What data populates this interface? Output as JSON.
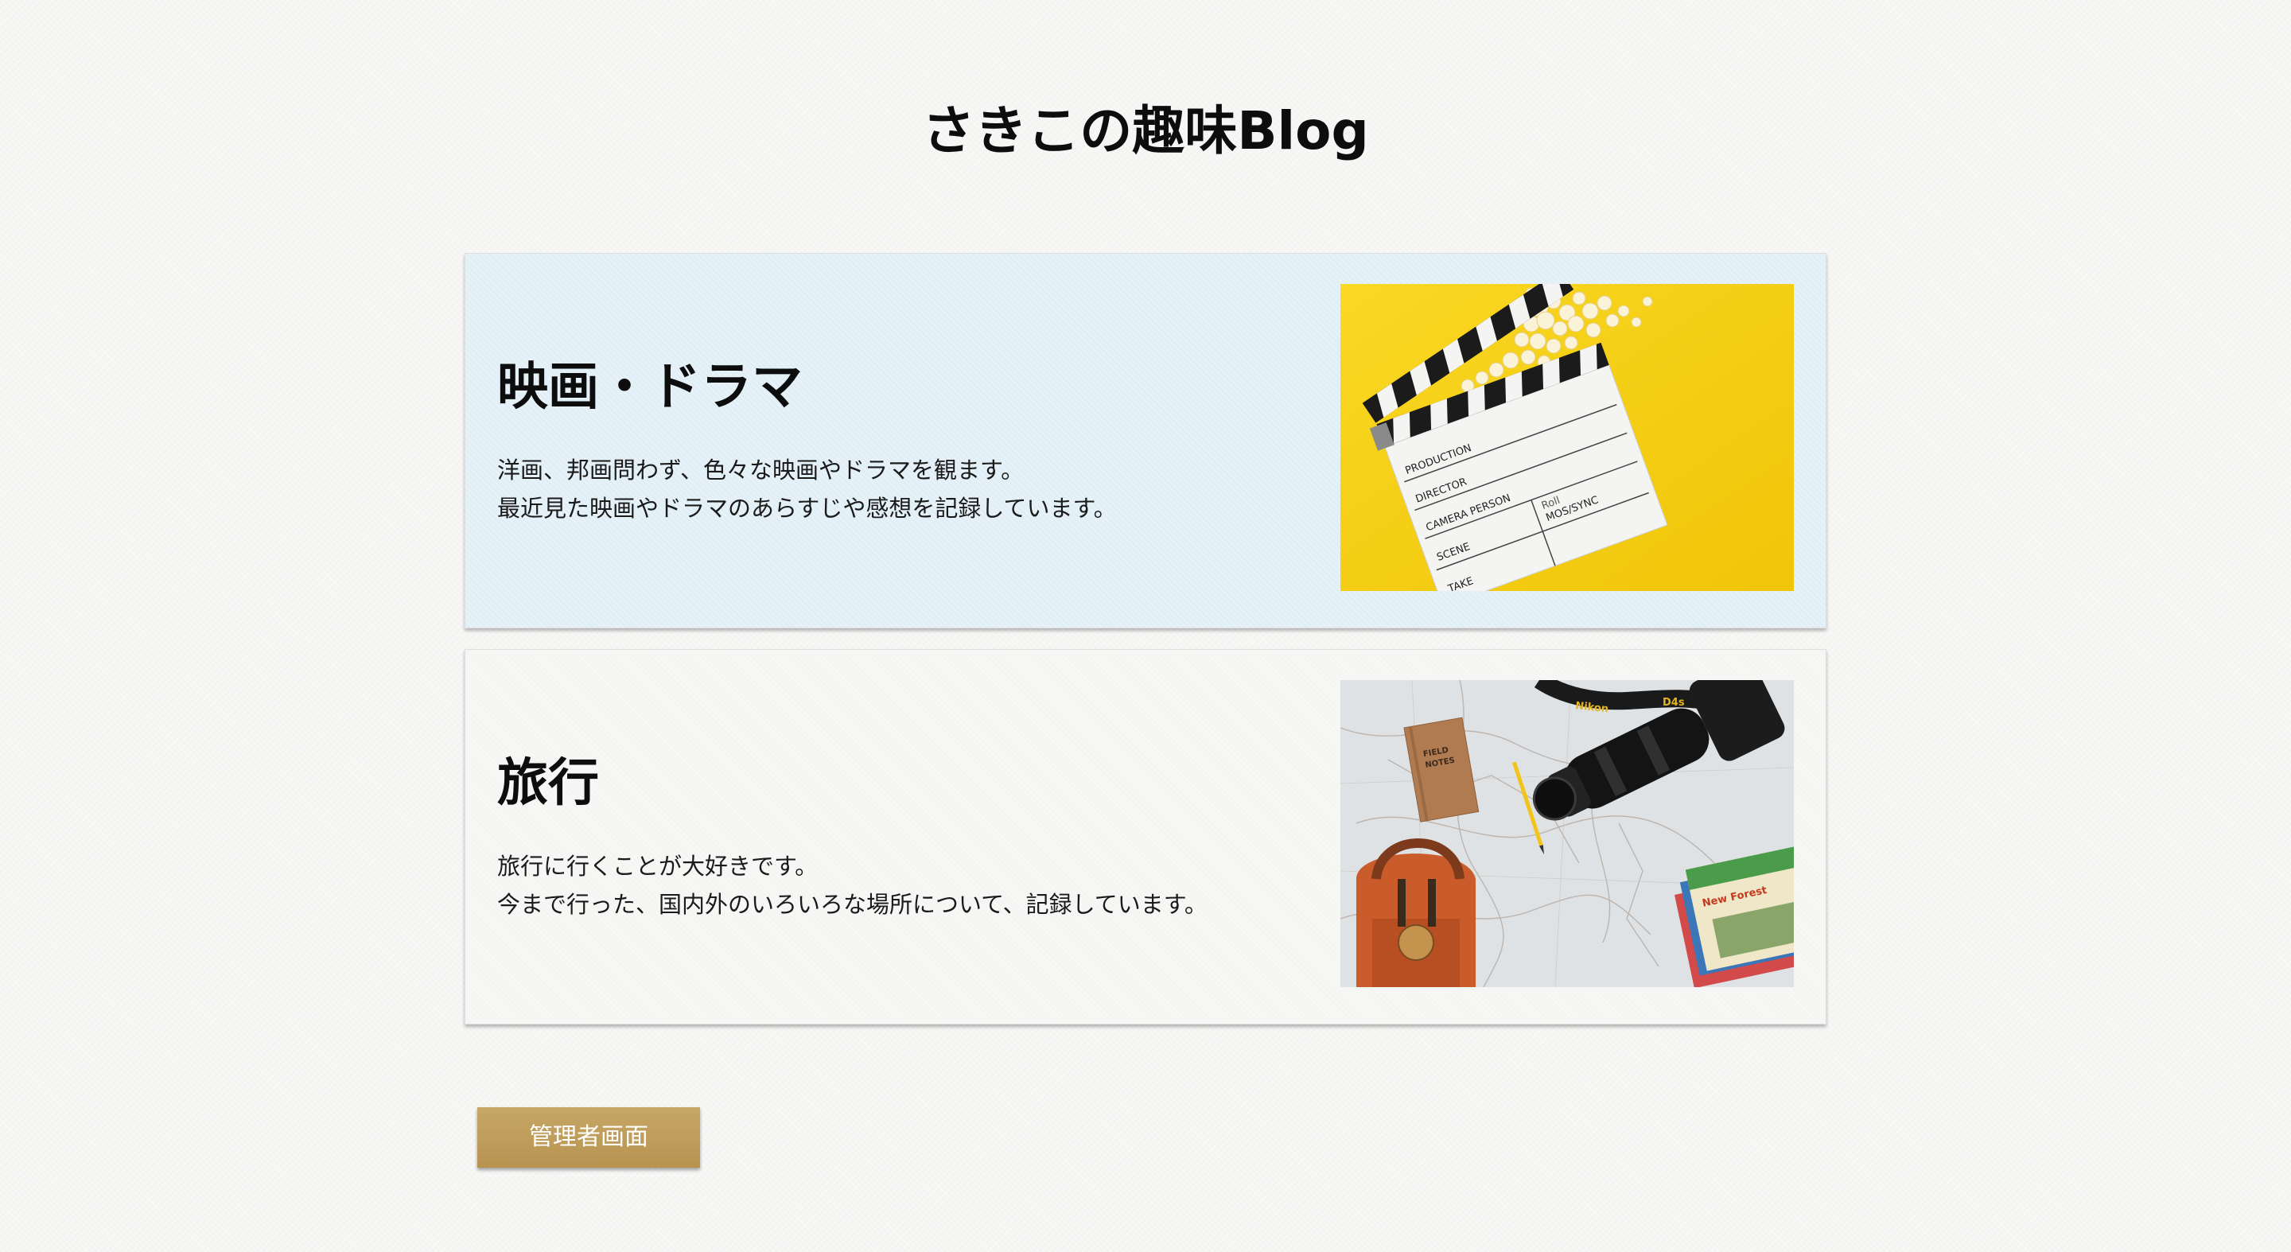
{
  "site": {
    "title": "さきこの趣味Blog"
  },
  "cards": [
    {
      "title": "映画・ドラマ",
      "description_lines": [
        "洋画、邦画問わず、色々な映画やドラマを観ます。",
        "最近見た映画やドラマのあらすじや感想を記録しています。"
      ],
      "image": {
        "subject": "clapperboard-with-popcorn-photo",
        "background_color": "#f5cf0f",
        "clapper_labels": [
          "PRODUCTION",
          "DIRECTOR",
          "CAMERA PERSON",
          "SCENE",
          "TAKE",
          "Roll",
          "MOS/SYNC"
        ]
      },
      "background_color": "#e0eef6"
    },
    {
      "title": "旅行",
      "description_lines": [
        "旅行に行くことが大好きです。",
        "今まで行った、国内外のいろいろな場所について、記録しています。"
      ],
      "image": {
        "subject": "travel-map-camera-backpack-photo",
        "background_color": "#dfe2e4",
        "notebook_label": "FIELD NOTES",
        "strap_label": "Nikon D4s",
        "map_label": "New Forest"
      },
      "background_color": "#f7f7f6"
    }
  ],
  "admin": {
    "button_label": "管理者画面",
    "button_color": "#bf9c5a"
  }
}
